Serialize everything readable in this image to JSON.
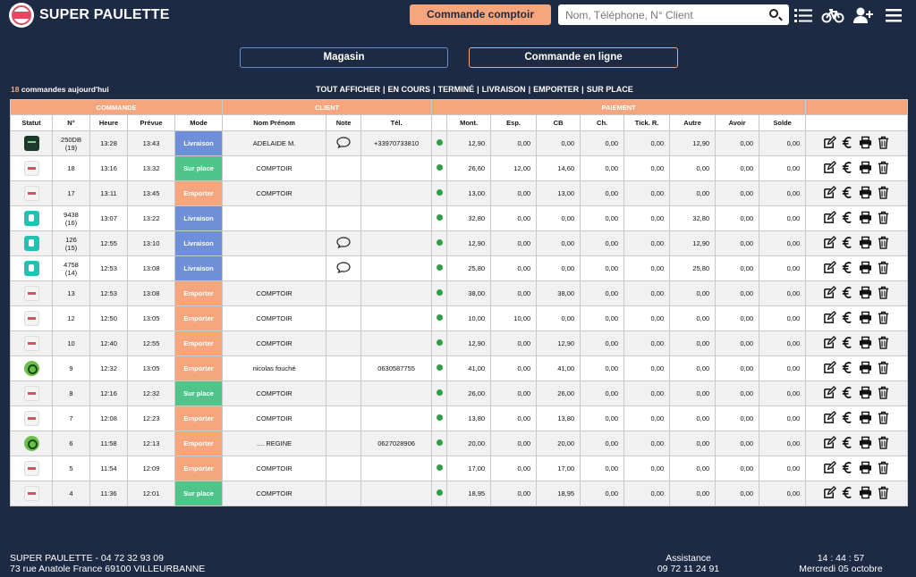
{
  "header": {
    "brand": "SUPER PAULETTE",
    "commande_comptoir": "Commande comptoir",
    "search_placeholder": "Nom, Téléphone, N° Client"
  },
  "tabs": {
    "magasin": "Magasin",
    "en_ligne": "Commande en ligne"
  },
  "summary": {
    "count": "18",
    "label": " commandes aujourd'hui"
  },
  "filters": [
    "TOUT AFFICHER",
    "EN COURS",
    "TERMINÉ",
    "LIVRAISON",
    "EMPORTER",
    "SUR PLACE"
  ],
  "table": {
    "groups": {
      "commande": "COMMANDE",
      "client": "CLIENT",
      "paiement": "PAIEMENT"
    },
    "columns": [
      "Statut",
      "N°",
      "Heure",
      "Prévue",
      "Mode",
      "Nom Prénom",
      "Note",
      "Tél.",
      "",
      "Mont.",
      "Esp.",
      "CB",
      "Ch.",
      "Tick. R.",
      "Autre",
      "Avoir",
      "Solde",
      ""
    ],
    "rows": [
      {
        "source": "uber",
        "no": "250DB",
        "sub": "(19)",
        "heure": "13:28",
        "prevue": "13:43",
        "mode": "Livraison",
        "mode_class": "livraison",
        "nom": "ADELAIDE M.",
        "note": true,
        "tel": "+33970733810",
        "mont": "12,90",
        "esp": "0,00",
        "cb": "0,00",
        "ch": "0,00",
        "tick": "0,00",
        "autre": "12,90",
        "avoir": "0,00",
        "solde": "0,00"
      },
      {
        "source": "paulette",
        "no": "18",
        "sub": "",
        "heure": "13:16",
        "prevue": "13:32",
        "mode": "Sur place",
        "mode_class": "surplace",
        "nom": "COMPTOIR",
        "note": false,
        "tel": "",
        "mont": "26,60",
        "esp": "12,00",
        "cb": "14,60",
        "ch": "0,00",
        "tick": "0,00",
        "autre": "0,00",
        "avoir": "0,00",
        "solde": "0,00"
      },
      {
        "source": "paulette",
        "no": "17",
        "sub": "",
        "heure": "13:11",
        "prevue": "13:45",
        "mode": "Emporter",
        "mode_class": "emporter",
        "nom": "COMPTOIR",
        "note": false,
        "tel": "",
        "mont": "13,00",
        "esp": "0,00",
        "cb": "13,00",
        "ch": "0,00",
        "tick": "0,00",
        "autre": "0,00",
        "avoir": "0,00",
        "solde": "0,00"
      },
      {
        "source": "deliveroo",
        "no": "9438",
        "sub": "(16)",
        "heure": "13:07",
        "prevue": "13:22",
        "mode": "Livraison",
        "mode_class": "livraison",
        "nom": "",
        "note": false,
        "tel": "",
        "mont": "32,80",
        "esp": "0,00",
        "cb": "0,00",
        "ch": "0,00",
        "tick": "0,00",
        "autre": "32,80",
        "avoir": "0,00",
        "solde": "0,00"
      },
      {
        "source": "deliveroo",
        "no": "126",
        "sub": "(15)",
        "heure": "12:55",
        "prevue": "13:10",
        "mode": "Livraison",
        "mode_class": "livraison",
        "nom": "",
        "note": true,
        "tel": "",
        "mont": "12,90",
        "esp": "0,00",
        "cb": "0,00",
        "ch": "0,00",
        "tick": "0,00",
        "autre": "12,90",
        "avoir": "0,00",
        "solde": "0,00"
      },
      {
        "source": "deliveroo",
        "no": "4758",
        "sub": "(14)",
        "heure": "12:53",
        "prevue": "13:08",
        "mode": "Livraison",
        "mode_class": "livraison",
        "nom": "",
        "note": true,
        "tel": "",
        "mont": "25,80",
        "esp": "0,00",
        "cb": "0,00",
        "ch": "0,00",
        "tick": "0,00",
        "autre": "25,80",
        "avoir": "0,00",
        "solde": "0,00"
      },
      {
        "source": "paulette",
        "no": "13",
        "sub": "",
        "heure": "12:53",
        "prevue": "13:08",
        "mode": "Emporter",
        "mode_class": "emporter",
        "nom": "COMPTOIR",
        "note": false,
        "tel": "",
        "mont": "38,00",
        "esp": "0,00",
        "cb": "38,00",
        "ch": "0,00",
        "tick": "0,00",
        "autre": "0,00",
        "avoir": "0,00",
        "solde": "0,00"
      },
      {
        "source": "paulette",
        "no": "12",
        "sub": "",
        "heure": "12:50",
        "prevue": "13:05",
        "mode": "Emporter",
        "mode_class": "emporter",
        "nom": "COMPTOIR",
        "note": false,
        "tel": "",
        "mont": "10,00",
        "esp": "10,00",
        "cb": "0,00",
        "ch": "0,00",
        "tick": "0,00",
        "autre": "0,00",
        "avoir": "0,00",
        "solde": "0,00"
      },
      {
        "source": "paulette",
        "no": "10",
        "sub": "",
        "heure": "12:40",
        "prevue": "12:55",
        "mode": "Emporter",
        "mode_class": "emporter",
        "nom": "COMPTOIR",
        "note": false,
        "tel": "",
        "mont": "12,90",
        "esp": "0,00",
        "cb": "12,90",
        "ch": "0,00",
        "tick": "0,00",
        "autre": "0,00",
        "avoir": "0,00",
        "solde": "0,00"
      },
      {
        "source": "web",
        "no": "9",
        "sub": "",
        "heure": "12:32",
        "prevue": "13:05",
        "mode": "Emporter",
        "mode_class": "emporter",
        "nom": "nicolas fouché",
        "note": false,
        "tel": "0630587755",
        "mont": "41,00",
        "esp": "0,00",
        "cb": "41,00",
        "ch": "0,00",
        "tick": "0,00",
        "autre": "0,00",
        "avoir": "0,00",
        "solde": "0,00"
      },
      {
        "source": "paulette",
        "no": "8",
        "sub": "",
        "heure": "12:16",
        "prevue": "12:32",
        "mode": "Sur place",
        "mode_class": "surplace",
        "nom": "COMPTOIR",
        "note": false,
        "tel": "",
        "mont": "26,00",
        "esp": "0,00",
        "cb": "26,00",
        "ch": "0,00",
        "tick": "0,00",
        "autre": "0,00",
        "avoir": "0,00",
        "solde": "0,00"
      },
      {
        "source": "paulette",
        "no": "7",
        "sub": "",
        "heure": "12:08",
        "prevue": "12:23",
        "mode": "Emporter",
        "mode_class": "emporter",
        "nom": "COMPTOIR",
        "note": false,
        "tel": "",
        "mont": "13,80",
        "esp": "0,00",
        "cb": "13,80",
        "ch": "0,00",
        "tick": "0,00",
        "autre": "0,00",
        "avoir": "0,00",
        "solde": "0,00"
      },
      {
        "source": "web",
        "no": "6",
        "sub": "",
        "heure": "11:58",
        "prevue": "12:13",
        "mode": "Emporter",
        "mode_class": "emporter",
        "nom": ".... REGINE",
        "note": false,
        "tel": "0627028906",
        "mont": "20,00",
        "esp": "0,00",
        "cb": "20,00",
        "ch": "0,00",
        "tick": "0,00",
        "autre": "0,00",
        "avoir": "0,00",
        "solde": "0,00"
      },
      {
        "source": "paulette",
        "no": "5",
        "sub": "",
        "heure": "11:54",
        "prevue": "12:09",
        "mode": "Emporter",
        "mode_class": "emporter",
        "nom": "COMPTOIR",
        "note": false,
        "tel": "",
        "mont": "17,00",
        "esp": "0,00",
        "cb": "17,00",
        "ch": "0,00",
        "tick": "0,00",
        "autre": "0,00",
        "avoir": "0,00",
        "solde": "0,00"
      },
      {
        "source": "paulette",
        "no": "4",
        "sub": "",
        "heure": "11:36",
        "prevue": "12:01",
        "mode": "Sur place",
        "mode_class": "surplace",
        "nom": "COMPTOIR",
        "note": false,
        "tel": "",
        "mont": "18,95",
        "esp": "0,00",
        "cb": "18,95",
        "ch": "0,00",
        "tick": "0,00",
        "autre": "0,00",
        "avoir": "0,00",
        "solde": "0,00"
      }
    ]
  },
  "footer": {
    "shop_line1": "SUPER PAULETTE - 04 72 32 93 09",
    "shop_line2": "73 rue Anatole France 69100 VILLEURBANNE",
    "assist_label": "Assistance",
    "assist_phone": "09 72 11 24 91",
    "time": "14 : 44 : 57",
    "date": "Mercredi 05 octobre"
  }
}
